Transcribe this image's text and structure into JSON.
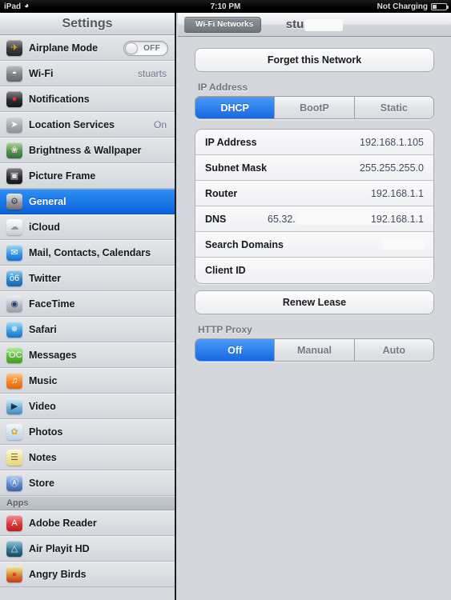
{
  "statusbar": {
    "device": "iPad",
    "wifi_icon": "wifi-icon",
    "time": "7:10 PM",
    "power": "Not Charging",
    "battery_icon": "battery-icon"
  },
  "sidebar": {
    "title": "Settings",
    "items": [
      {
        "label": "Airplane Mode",
        "icon": "airplane-icon",
        "glyph": "✈",
        "icon_bg": "linear-gradient(#5a5a5c,#242425)",
        "icon_color": "#f7a400",
        "control": "toggle",
        "toggle_text": "OFF",
        "toggle_on": false
      },
      {
        "label": "Wi-Fi",
        "icon": "wifi-settings-icon",
        "glyph": "◓",
        "icon_bg": "linear-gradient(#9aa0a6,#63686e)",
        "icon_color": "#ffffff",
        "value": "stuarts"
      },
      {
        "label": "Notifications",
        "icon": "notifications-icon",
        "glyph": "●",
        "icon_bg": "linear-gradient(#4b4b4d,#151516)",
        "icon_color": "#e8232a"
      },
      {
        "label": "Location Services",
        "icon": "location-arrow-icon",
        "glyph": "➤",
        "icon_bg": "linear-gradient(#bfc4ca,#8d939a)",
        "icon_color": "#ffffff",
        "value": "On"
      },
      {
        "label": "Brightness & Wallpaper",
        "icon": "brightness-wallpaper-icon",
        "glyph": "❀",
        "icon_bg": "linear-gradient(#7fc06c,#2f6f3b)",
        "icon_color": "#ffd8e6"
      },
      {
        "label": "Picture Frame",
        "icon": "picture-frame-icon",
        "glyph": "▣",
        "icon_bg": "linear-gradient(#4a4a4c,#161617)",
        "icon_color": "#dfe3e8"
      },
      {
        "label": "General",
        "icon": "general-gear-icon",
        "glyph": "⚙",
        "icon_bg": "linear-gradient(#d2d6da,#6e7276)",
        "icon_color": "#2b2f33",
        "selected": true
      },
      {
        "label": "iCloud",
        "icon": "icloud-icon",
        "glyph": "☁",
        "icon_bg": "linear-gradient(#fdfdfd,#c8ccd2)",
        "icon_color": "#8d949c"
      },
      {
        "label": "Mail, Contacts, Calendars",
        "icon": "mail-icon",
        "glyph": "✉",
        "icon_bg": "linear-gradient(#6fc5f5,#1a6fd4)",
        "icon_color": "#ffffff"
      },
      {
        "label": "Twitter",
        "icon": "twitter-icon",
        "glyph": "ὂ6",
        "icon_bg": "linear-gradient(#4fb3e8,#1565b0)",
        "icon_color": "#ffffff"
      },
      {
        "label": "FaceTime",
        "icon": "facetime-icon",
        "glyph": "◉",
        "icon_bg": "linear-gradient(#dfe3e8,#9aa0a7)",
        "icon_color": "#1c3d6e"
      },
      {
        "label": "Safari",
        "icon": "safari-compass-icon",
        "glyph": "✵",
        "icon_bg": "linear-gradient(#74d0f7,#1a74c8)",
        "icon_color": "#ffffff"
      },
      {
        "label": "Messages",
        "icon": "messages-bubble-icon",
        "glyph": "ὊC",
        "icon_bg": "linear-gradient(#8ee26a,#3ba018)",
        "icon_color": "#ffffff"
      },
      {
        "label": "Music",
        "icon": "music-note-icon",
        "glyph": "♫",
        "icon_bg": "linear-gradient(#ffb04a,#e8620d)",
        "icon_color": "#ffffff"
      },
      {
        "label": "Video",
        "icon": "video-clapper-icon",
        "glyph": "▶",
        "icon_bg": "linear-gradient(#bfe6f7,#3d8bbb)",
        "icon_color": "#13334a"
      },
      {
        "label": "Photos",
        "icon": "photos-sunflower-icon",
        "glyph": "✿",
        "icon_bg": "linear-gradient(#e9f3fb,#b9d4e8)",
        "icon_color": "#e8a400"
      },
      {
        "label": "Notes",
        "icon": "notes-icon",
        "glyph": "☰",
        "icon_bg": "linear-gradient(#fdf2b8,#e8d77a)",
        "icon_color": "#6b5a17"
      },
      {
        "label": "Store",
        "icon": "store-icon",
        "glyph": "Ⓐ",
        "icon_bg": "linear-gradient(#8fb8e8,#3a63ad)",
        "icon_color": "#ffffff"
      }
    ],
    "apps_group": "Apps",
    "apps": [
      {
        "label": "Adobe Reader",
        "icon": "adobe-reader-icon",
        "glyph": "A",
        "icon_bg": "linear-gradient(#f25b5b,#c41d1d)",
        "icon_color": "#ffffff"
      },
      {
        "label": "Air Playit HD",
        "icon": "air-playit-hd-icon",
        "glyph": "△",
        "icon_bg": "linear-gradient(#5fa8c4,#134a63)",
        "icon_color": "#d8f1fb"
      },
      {
        "label": "Angry Birds",
        "icon": "angry-birds-icon",
        "glyph": "●",
        "icon_bg": "linear-gradient(#f5d95e,#c23a1c)",
        "icon_color": "#e03a20"
      }
    ]
  },
  "detail": {
    "back_button": "Wi-Fi Networks",
    "title": "stu",
    "title_redacted": true,
    "forget_button": "Forget this Network",
    "ip_address_label": "IP Address",
    "ip_modes": [
      {
        "label": "DHCP",
        "active": true
      },
      {
        "label": "BootP",
        "active": false
      },
      {
        "label": "Static",
        "active": false
      }
    ],
    "rows": [
      {
        "key": "IP Address",
        "value": "192.168.1.105"
      },
      {
        "key": "Subnet Mask",
        "value": "255.255.255.0"
      },
      {
        "key": "Router",
        "value": "192.168.1.1"
      },
      {
        "key": "DNS",
        "value": "192.168.1.1",
        "mid": "65.32.",
        "mid_redacted": true
      },
      {
        "key": "Search Domains",
        "value": "",
        "value_redacted": true
      },
      {
        "key": "Client ID",
        "value": ""
      }
    ],
    "renew_button": "Renew Lease",
    "http_proxy_label": "HTTP Proxy",
    "proxy_modes": [
      {
        "label": "Off",
        "active": true
      },
      {
        "label": "Manual",
        "active": false
      },
      {
        "label": "Auto",
        "active": false
      }
    ]
  },
  "colors": {
    "accent_blue": "#1667e0",
    "selected_row": "#0a61d8",
    "panel_bg": "#d5d7dc",
    "value_text": "#3e4a5c"
  }
}
